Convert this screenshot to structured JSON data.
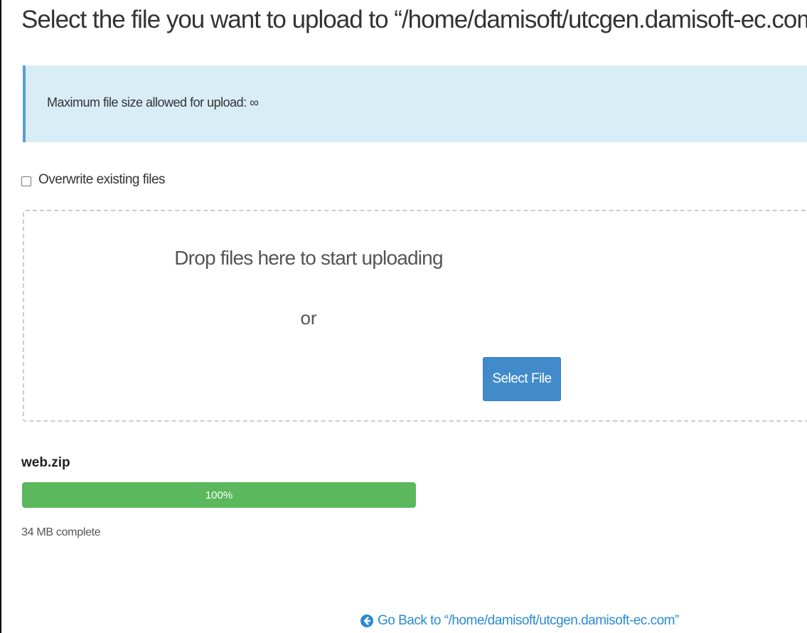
{
  "header": {
    "title": "Select the file you want to upload to “/home/damisoft/utcgen.damisoft-ec.com”."
  },
  "alert": {
    "text": "Maximum file size allowed for upload: ∞"
  },
  "options": {
    "overwrite_label": "Overwrite existing files",
    "overwrite_checked": false
  },
  "dropzone": {
    "drop_text": "Drop files here to start uploading",
    "or_text": "or",
    "select_button_label": "Select File"
  },
  "upload": {
    "file_name": "web.zip",
    "progress_label": "100%",
    "progress_fraction": 1.0,
    "status_text": "34 MB complete"
  },
  "footer": {
    "back_link_label": "Go Back to “/home/damisoft/utcgen.damisoft-ec.com”",
    "back_icon": "arrow-circle-left-icon"
  },
  "colors": {
    "accent": "#428bca",
    "alert_bg": "#d9edf7",
    "progress": "#5cb85c",
    "link": "#2a8bd2"
  }
}
